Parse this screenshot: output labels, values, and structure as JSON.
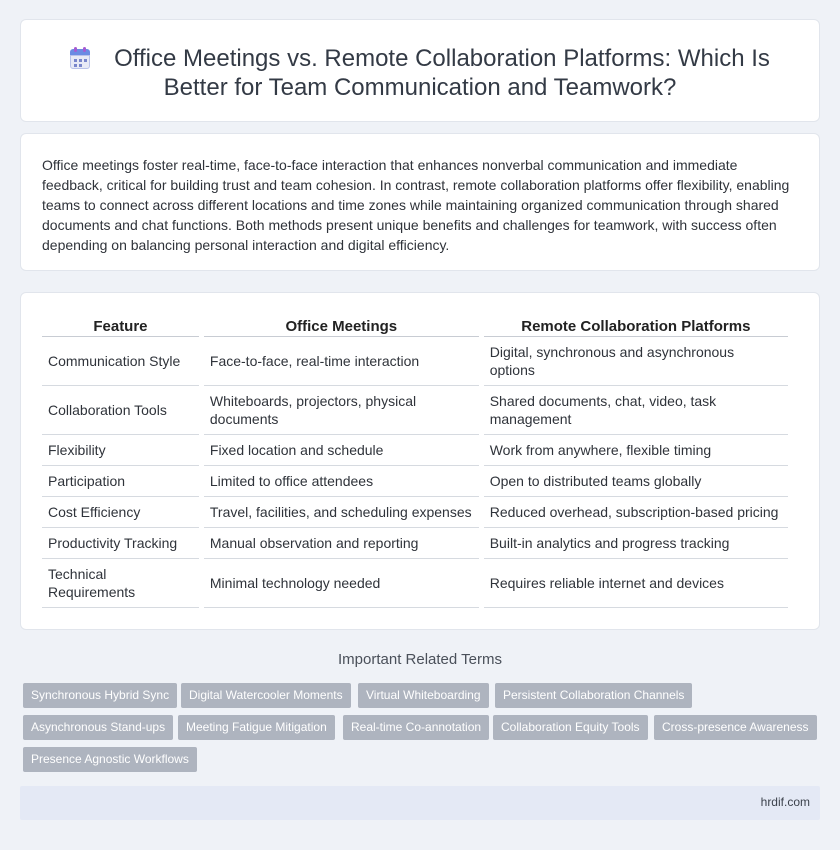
{
  "header": {
    "title_line1": "Office Meetings vs. Remote Collaboration Platforms: Which Is",
    "title_line2": "Better for Team Communication and Teamwork?",
    "icon": "calendar-icon"
  },
  "intro": {
    "text": "Office meetings foster real-time, face-to-face interaction that enhances nonverbal communication and immediate feedback, critical for building trust and team cohesion. In contrast, remote collaboration platforms offer flexibility, enabling teams to connect across different locations and time zones while maintaining organized communication through shared documents and chat functions. Both methods present unique benefits and challenges for teamwork, with success often depending on balancing personal interaction and digital efficiency."
  },
  "table": {
    "headers": [
      "Feature",
      "Office Meetings",
      "Remote Collaboration Platforms"
    ],
    "rows": [
      [
        "Communication Style",
        "Face-to-face, real-time interaction",
        "Digital, synchronous and asynchronous options"
      ],
      [
        "Collaboration Tools",
        "Whiteboards, projectors, physical documents",
        "Shared documents, chat, video, task management"
      ],
      [
        "Flexibility",
        "Fixed location and schedule",
        "Work from anywhere, flexible timing"
      ],
      [
        "Participation",
        "Limited to office attendees",
        "Open to distributed teams globally"
      ],
      [
        "Cost Efficiency",
        "Travel, facilities, and scheduling expenses",
        "Reduced overhead, subscription-based pricing"
      ],
      [
        "Productivity Tracking",
        "Manual observation and reporting",
        "Built-in analytics and progress tracking"
      ],
      [
        "Technical Requirements",
        "Minimal technology needed",
        "Requires reliable internet and devices"
      ]
    ]
  },
  "related": {
    "title": "Important Related Terms",
    "tags": [
      "Synchronous Hybrid Sync",
      "Digital Watercooler Moments",
      "Virtual Whiteboarding",
      "Persistent Collaboration Channels",
      "Asynchronous Stand-ups",
      "Meeting Fatigue Mitigation",
      "Real-time Co-annotation",
      "Collaboration Equity Tools",
      "Cross-presence Awareness",
      "Presence Agnostic Workflows"
    ]
  },
  "footer": {
    "site": "hrdif.com"
  },
  "colors": {
    "background": "#eff2f7",
    "tag_bg": "#aeb4bf",
    "footer_bg": "#e4e9f5"
  }
}
